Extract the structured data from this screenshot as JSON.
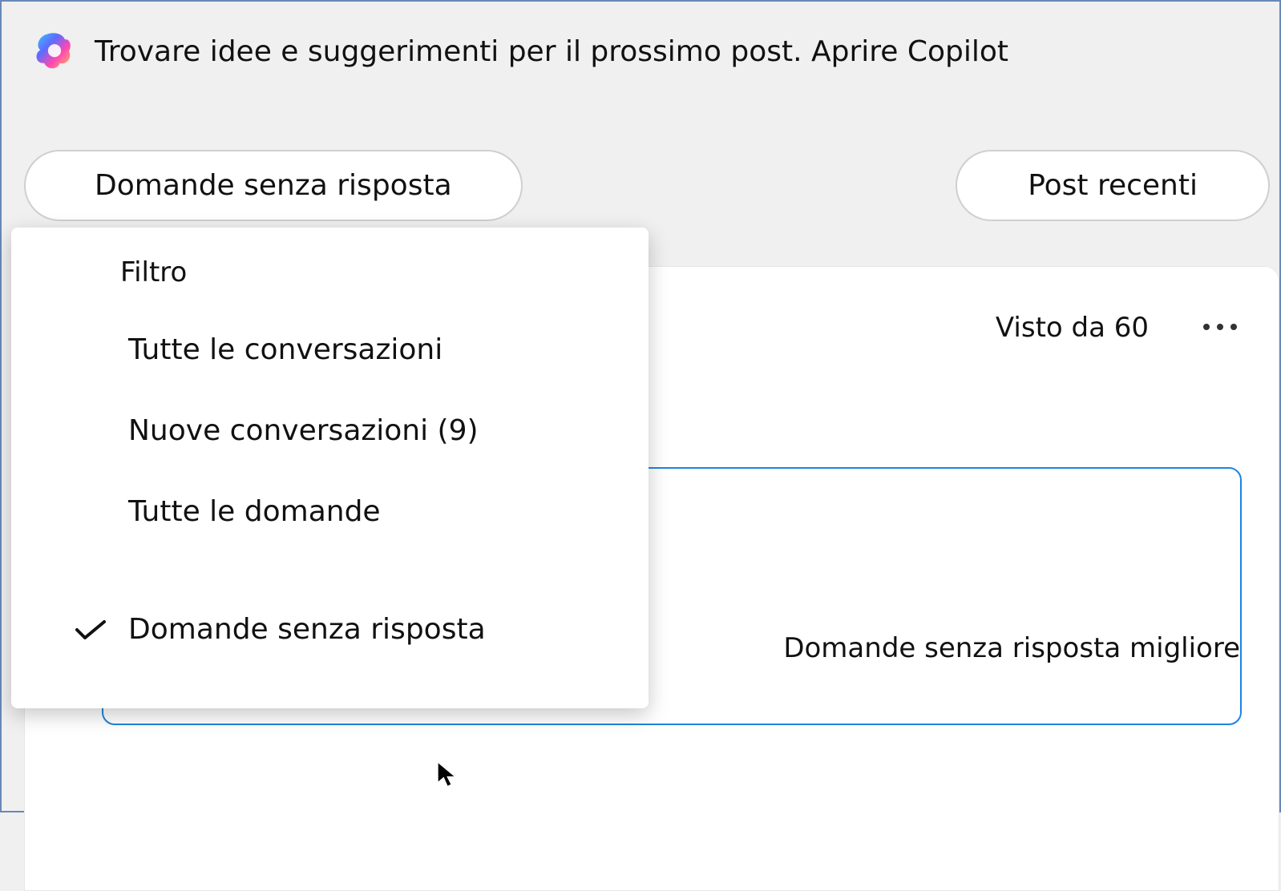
{
  "copilot": {
    "text": "Trovare idee e suggerimenti per il prossimo post. Aprire Copilot"
  },
  "pills": {
    "left": "Domande senza risposta",
    "right": "Post recenti"
  },
  "card": {
    "seen": "Visto da 60",
    "answer_tag": "Domande senza risposta migliore"
  },
  "filter_menu": {
    "header": "Filtro",
    "items": [
      "Tutte le conversazioni",
      "Nuove conversazioni (9)",
      "Tutte le domande",
      "Domande senza risposta"
    ],
    "selected_index": 3
  }
}
